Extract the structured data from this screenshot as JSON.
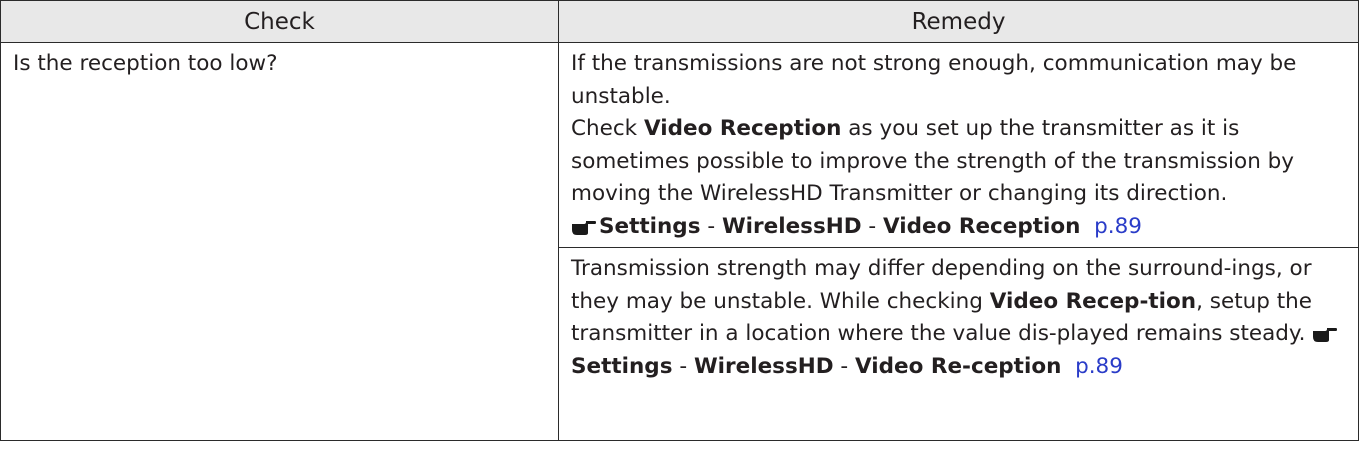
{
  "table": {
    "headers": {
      "check": "Check",
      "remedy": "Remedy"
    },
    "row": {
      "check": "Is the reception too low?",
      "remedy1": {
        "line1": "If the transmissions are not strong enough, communication may be unstable.",
        "p2_a": "Check ",
        "p2_bold": "Video Reception",
        "p2_b": " as you set up the transmitter as it is sometimes possible to improve the strength of the transmission by moving the WirelessHD Transmitter or changing its direction.",
        "ref_menu1": "Settings",
        "ref_sep1": " - ",
        "ref_menu2": "WirelessHD",
        "ref_sep2": " - ",
        "ref_menu3": "Video Reception",
        "ref_page": "p.89"
      },
      "remedy2": {
        "t1": "Transmission strength may differ depending on the surround-ings, or they may be unstable. While checking ",
        "bold1": "Video Recep-tion",
        "t2": ", setup the transmitter in a location where the value dis-played remains steady. ",
        "ref_menu1": "Settings",
        "ref_sep1": " - ",
        "ref_menu2": "WirelessHD",
        "ref_sep2": " - ",
        "ref_menu3": "Video Re-ception",
        "ref_page": "p.89"
      }
    }
  },
  "icons": {
    "reference": "pointing-hand-icon"
  },
  "colors": {
    "link": "#2a3cc8",
    "header_bg": "#e8e8e8",
    "border": "#2b2b2b"
  }
}
